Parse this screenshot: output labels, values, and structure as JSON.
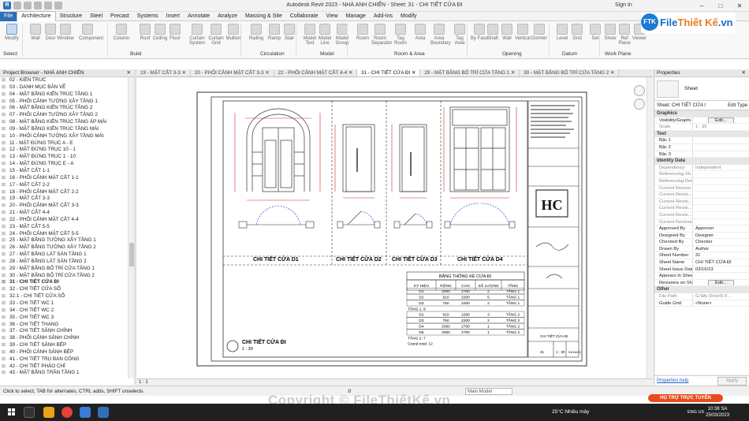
{
  "titlebar": {
    "title": "Autodesk Revit 2023 - NHÀ ANH CHIẾN - Sheet: 31 - CHI TIẾT CỬA ĐI",
    "sign_in": "Sign In",
    "app_icon": "R"
  },
  "menu": [
    "File",
    "Architecture",
    "Structure",
    "Steel",
    "Precast",
    "Systems",
    "Insert",
    "Annotate",
    "Analyze",
    "Massing & Site",
    "Collaborate",
    "View",
    "Manage",
    "Add-Ins",
    "Modify"
  ],
  "ribbon": {
    "buttons": [
      "Modify",
      "Wall",
      "Door",
      "Window",
      "Component",
      "Column",
      "Roof",
      "Ceiling",
      "Floor",
      "Curtain System",
      "Curtain Grid",
      "Mullion",
      "Railing",
      "Ramp",
      "Stair",
      "Model Text",
      "Model Line",
      "Model Group",
      "Room",
      "Room Separator",
      "Tag Room",
      "Area",
      "Area Boundary",
      "Tag Area",
      "By Face",
      "Shaft",
      "Wall",
      "Vertical",
      "Dormer",
      "Level",
      "Grid",
      "Set",
      "Show",
      "Ref Plane",
      "Viewer"
    ],
    "groups": [
      "Select",
      "Build",
      "Circulation",
      "Model",
      "Room & Area",
      "Opening",
      "Datum",
      "Work Plane"
    ]
  },
  "logo": {
    "brand_prefix": "File",
    "brand_main": "Thiết Kế",
    "brand_suffix": ".vn",
    "badge": "FTK"
  },
  "browser": {
    "title": "Project Browser - NHÀ ANH CHIẾN",
    "items": [
      "02 - KIẾN TRÚC",
      "03 - DANH MỤC BẢN VẼ",
      "04 - MẶT BẰNG KIẾN TRÚC TẦNG 1",
      "05 - PHỐI CẢNH TƯỜNG XÂY TẦNG 1",
      "06 - MẶT BẰNG KIẾN TRÚC TẦNG 2",
      "07 - PHỐI CẢNH TƯỜNG XÂY TẦNG 2",
      "08 - MẶT BẰNG KIẾN TRÚC TẦNG ÁP MÁI",
      "09 - MẶT BẰNG KIẾN TRÚC TẦNG MÁI",
      "10 - PHỐI CẢNH TƯỜNG XÂY TẦNG MÁI",
      "11 - MẶT ĐỨNG TRỤC A - E",
      "12 - MẶT ĐỨNG TRỤC 10 - 1",
      "13 - MẶT ĐỨNG TRỤC 1 - 10",
      "14 - MẶT ĐỨNG TRỤC E - A",
      "15 - MẶT CẮT 1-1",
      "16 - PHỐI CẢNH MẶT CẮT 1-1",
      "17 - MẶT CẮT 2-2",
      "18 - PHỐI CẢNH MẶT CẮT 2-2",
      "19 - MẶT CẮT 3-3",
      "20 - PHỐI CẢNH MẶT CẮT 3-3",
      "21 - MẶT CẮT 4-4",
      "22 - PHỐI CẢNH MẶT CẮT 4-4",
      "23 - MẶT CẮT 5-5",
      "24 - PHỐI CẢNH MẶT CẮT 5-5",
      "25 - MẶT BẰNG TƯỜNG XÂY TẦNG 1",
      "26 - MẶT BẰNG TƯỜNG XÂY TẦNG 2",
      "27 - MẶT BẰNG LÁT SÀN TẦNG 1",
      "28 - MẶT BẰNG LÁT SÀN TẦNG 2",
      "29 - MẶT BẰNG BỐ TRÍ CỬA TẦNG 1",
      "30 - MẶT BẰNG BỐ TRÍ CỬA TẦNG 2",
      "31 - CHI TIẾT CỬA ĐI",
      "32 - CHI TIẾT CỬA SỔ",
      "32.1 - CHI TIẾT CỬA SỔ",
      "33 - CHI TIẾT WC 1",
      "34 - CHI TIẾT WC 2",
      "35 - CHI TIẾT WC 3",
      "36 - CHI TIẾT THANG",
      "37 - CHI TIẾT SẢNH CHÍNH",
      "38 - PHỐI CẢNH SẢNH CHÍNH",
      "39 - CHI TIẾT SẢNH BẾP",
      "40 - PHỐI CẢNH SẢNH BẾP",
      "41 - CHI TIẾT TRỤ BAN CÔNG",
      "42 - CHI TIẾT PHÀO CHỈ",
      "43 - MẶT BẰNG TRẦN TẦNG 1"
    ],
    "selected_index": 29
  },
  "tabs": [
    "19 - MẶT CẮT 3-3",
    "20 - PHỐI CẢNH MẶT CẮT 3-3",
    "22 - PHỐI CẢNH MẶT CẮT 4-4",
    "31 - CHI TIẾT CỬA ĐI",
    "29 - MẶT BẰNG BỐ TRÍ CỬA TẦNG 1",
    "30 - MẶT BẰNG BỐ TRÍ CỬA TẦNG 2"
  ],
  "active_tab": 3,
  "sheet": {
    "door_labels": [
      "CHI TIẾT CỬA D1",
      "CHI TIẾT CỬA D2",
      "CHI TIẾT CỬA D3",
      "CHI TIẾT CỬA D4"
    ],
    "view_title": "CHI TIẾT CỬA ĐI",
    "view_scale": "1 : 30",
    "schedule": {
      "title": "BẢNG THỐNG KÊ CỬA ĐI",
      "headers": [
        "KÝ HIỆU",
        "RỘNG",
        "CAO",
        "SỐ LƯỢNG",
        "TẦNG"
      ],
      "rows": [
        [
          "D1",
          "2000",
          "2700",
          "2",
          "TẦNG 1"
        ],
        [
          "D2",
          "910",
          "2200",
          "5",
          "TẦNG 1"
        ],
        [
          "D3",
          "750",
          "2200",
          "2",
          "TẦNG 1"
        ],
        [
          "TẦNG 1: 9",
          "",
          "",
          "",
          ""
        ],
        [
          "D2",
          "910",
          "2200",
          "3",
          "TẦNG 2"
        ],
        [
          "D3",
          "750",
          "2200",
          "2",
          "TẦNG 2"
        ],
        [
          "D4",
          "2000",
          "2700",
          "1",
          "TẦNG 2"
        ],
        [
          "D5",
          "2000",
          "2700",
          "1",
          "TẦNG 2"
        ],
        [
          "TẦNG 2: 7",
          "",
          "",
          "",
          ""
        ],
        [
          "Grand total: 12",
          "",
          "",
          "",
          ""
        ]
      ]
    },
    "titleblock": {
      "logo": "HC",
      "box_label": "CHI TIẾT CỬA ĐI",
      "sheet_no": "31",
      "scale": "1 : 30",
      "date": "03/16/23"
    }
  },
  "view_control": {
    "scale": "1 : 1"
  },
  "properties": {
    "title": "Properties",
    "type_name": "Sheet",
    "selector": "Sheet: CHI TIẾT CỬA I",
    "edit_type": "Edit Type",
    "sections": [
      {
        "cat": "Graphics",
        "rows": [
          [
            "Visibility/Graphi...",
            "Edit..."
          ],
          [
            "Scale",
            "1 : 30"
          ]
        ]
      },
      {
        "cat": "Text",
        "rows": [
          [
            "Bậc 1",
            ""
          ],
          [
            "Bậc 2",
            ""
          ],
          [
            "Bậc 3",
            ""
          ]
        ]
      },
      {
        "cat": "Identity Data",
        "rows": [
          [
            "Dependency",
            "Independent"
          ],
          [
            "Referencing Sh...",
            ""
          ],
          [
            "Referencing Det...",
            ""
          ],
          [
            "Current Revisio...",
            ""
          ],
          [
            "Current Revisi...",
            ""
          ],
          [
            "Current Revisi...",
            ""
          ],
          [
            "Current Revisi...",
            ""
          ],
          [
            "Current Revisi...",
            ""
          ],
          [
            "Current Revision",
            ""
          ],
          [
            "Approved By",
            "Approver"
          ],
          [
            "Designed By",
            "Designer"
          ],
          [
            "Checked By",
            "Checker"
          ],
          [
            "Drawn By",
            "Author"
          ],
          [
            "Sheet Number",
            "31"
          ],
          [
            "Sheet Name",
            "CHI TIẾT CỬA ĐI"
          ],
          [
            "Sheet Issue Date",
            "03/16/23"
          ],
          [
            "Appears In Shee...",
            ""
          ],
          [
            "Revisions on She...",
            "Edit..."
          ]
        ]
      },
      {
        "cat": "Other",
        "rows": [
          [
            "File Path",
            "G:\\My Drive\\5.0 ..."
          ],
          [
            "Guide Grid",
            "<None>"
          ]
        ]
      }
    ],
    "help_link": "Properties help",
    "apply": "Apply"
  },
  "status": {
    "text": "Click to select, TAB for alternates, CTRL adds, SHIFT unselects.",
    "zero": ":0",
    "model": "Main Model"
  },
  "watermark": "Copyright © FileThiếtKế.vn",
  "banner": "HỌ TRỢ TRỰC TUYẾN",
  "taskbar": {
    "weather": "25°C Nhiều mây",
    "lang": "ENG US",
    "time": "10:38 SA",
    "date": "25/03/2023"
  }
}
